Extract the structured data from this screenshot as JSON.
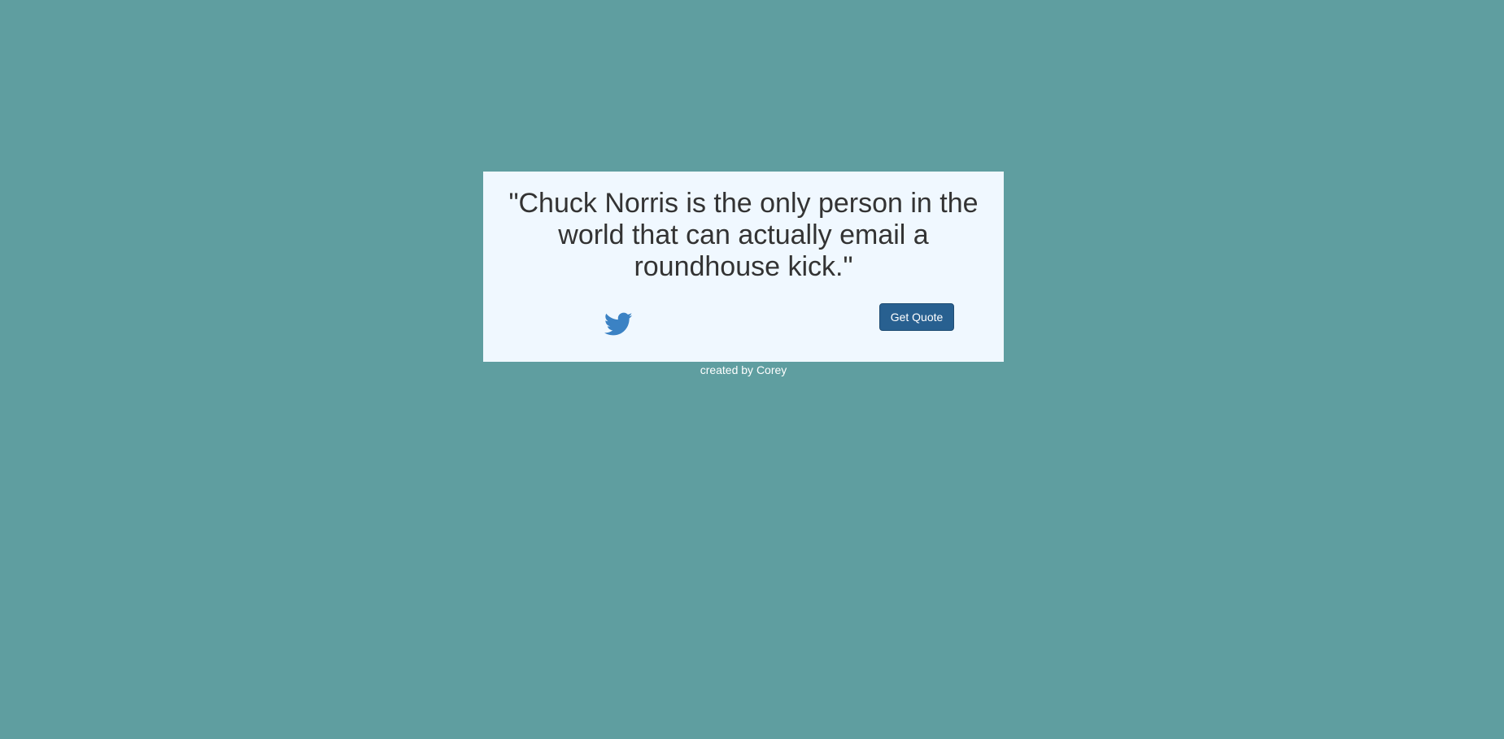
{
  "quote": {
    "text": "\"Chuck Norris is the only person in the world that can actually email a roundhouse kick.\""
  },
  "actions": {
    "tweet_icon": "twitter-icon",
    "get_quote_label": "Get Quote"
  },
  "footer": {
    "credit": "created by Corey"
  },
  "colors": {
    "background": "#5f9ea0",
    "card": "#f0f8ff",
    "button": "#286090",
    "twitter": "#3b82c4",
    "text": "#333333"
  }
}
